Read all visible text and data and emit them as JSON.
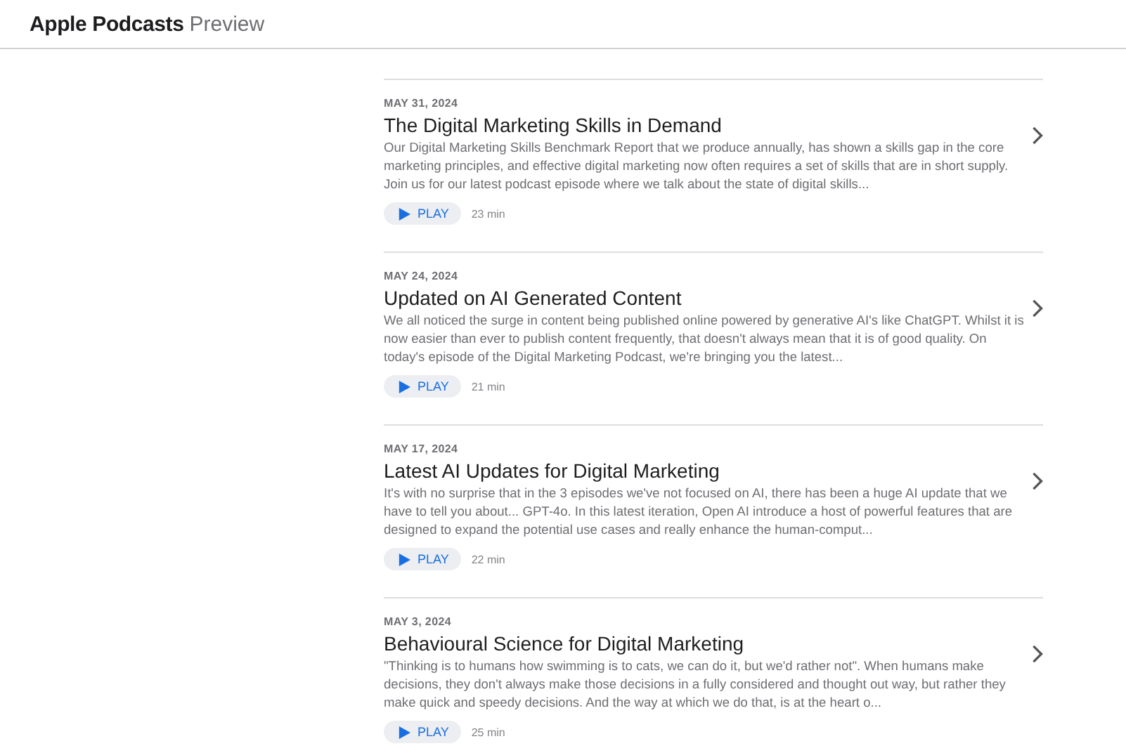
{
  "header": {
    "brand": "Apple Podcasts",
    "suffix": "Preview"
  },
  "episodes": [
    {
      "date": "MAY 31, 2024",
      "title": "The Digital Marketing Skills in Demand",
      "description": "Our Digital Marketing Skills Benchmark Report that we produce annually, has shown a skills gap in the core marketing principles, and effective digital marketing now often requires a set of skills that are in short supply. Join us for our latest podcast episode where we talk about the state of digital skills...",
      "play": "PLAY",
      "duration": "23 min"
    },
    {
      "date": "MAY 24, 2024",
      "title": "Updated on AI Generated Content",
      "description": "We all noticed the surge in content being published online powered by generative AI's like ChatGPT. Whilst it is now easier than ever to publish content frequently, that doesn't always mean that it is of good quality. On today's episode of the Digital Marketing Podcast, we're bringing you the latest...",
      "play": "PLAY",
      "duration": "21 min"
    },
    {
      "date": "MAY 17, 2024",
      "title": "Latest AI Updates for Digital Marketing",
      "description": "It's with no surprise that in the 3 episodes we've not focused on AI, there has been a huge AI update that we have to tell you about... GPT-4o. In this latest iteration, Open AI introduce a host of powerful features that are designed to expand the potential use cases and really enhance the human-comput...",
      "play": "PLAY",
      "duration": "22 min"
    },
    {
      "date": "MAY 3, 2024",
      "title": "Behavioural Science for Digital Marketing",
      "description": "\"Thinking is to humans how swimming is to cats, we can do it, but we'd rather not\". When humans make decisions, they don't always make those decisions in a fully considered and thought out way, but rather they make quick and speedy decisions. And the way at which we do that, is at the heart o...",
      "play": "PLAY",
      "duration": "25 min"
    }
  ]
}
